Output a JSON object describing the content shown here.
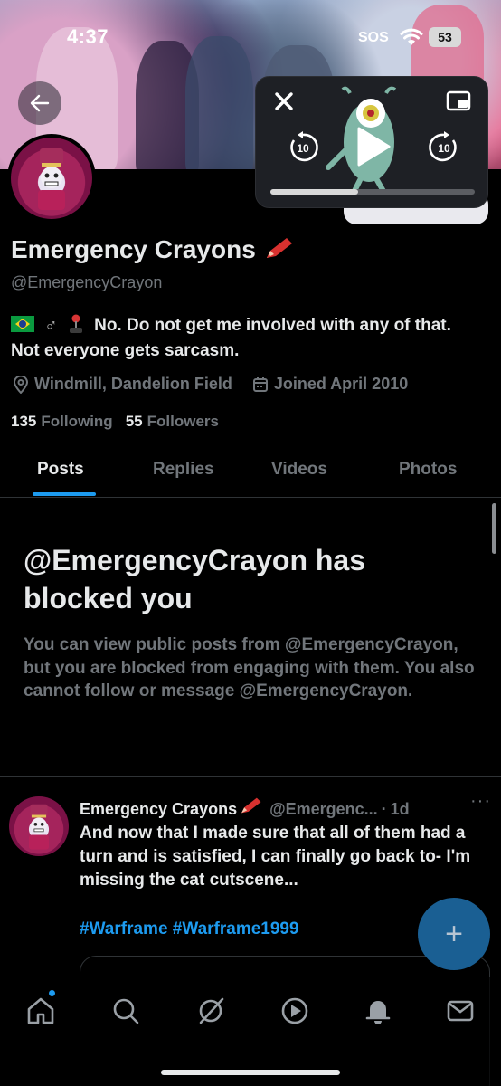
{
  "status_bar": {
    "time": "4:37",
    "signal": "SOS",
    "battery": "53"
  },
  "profile": {
    "name": "Emergency Crayons",
    "name_emoji": "crayon-icon",
    "handle": "@EmergencyCrayon",
    "bio_text": "No. Do not get me involved with any of that. Not everyone gets sarcasm.",
    "bio_icons": [
      "brazil-flag-icon",
      "male-sign-icon",
      "joystick-icon"
    ],
    "location": "Windmill, Dandelion Field",
    "joined": "Joined April 2010",
    "following_count": "135",
    "following_label": "Following",
    "followers_count": "55",
    "followers_label": "Followers"
  },
  "tabs": [
    {
      "label": "Posts",
      "active": true
    },
    {
      "label": "Replies",
      "active": false
    },
    {
      "label": "Videos",
      "active": false
    },
    {
      "label": "Photos",
      "active": false
    }
  ],
  "blocked": {
    "title": "@EmergencyCrayon has blocked you",
    "description": "You can view public posts from @EmergencyCrayon, but you are blocked from engaging with them. You also cannot follow or message @EmergencyCrayon."
  },
  "pip": {
    "skip_back": "10",
    "skip_forward": "10",
    "progress": 0.43
  },
  "post": {
    "author": "Emergency Crayons",
    "handle": "@Emergenc...",
    "separator": "·",
    "time": "1d",
    "more": "···",
    "text": "And now that I made sure that all of them had a turn and is satisfied, I can finally go back to- I'm missing the cat cutscene...",
    "hashtags": "#Warframe #Warframe1999"
  },
  "fab": {
    "label": "+"
  },
  "nav": [
    "home-icon",
    "search-icon",
    "grok-icon",
    "video-icon",
    "notifications-icon",
    "messages-icon"
  ],
  "colors": {
    "accent": "#1d9bf0",
    "muted": "#71767b",
    "text": "#e7e9ea",
    "background": "#000000"
  }
}
